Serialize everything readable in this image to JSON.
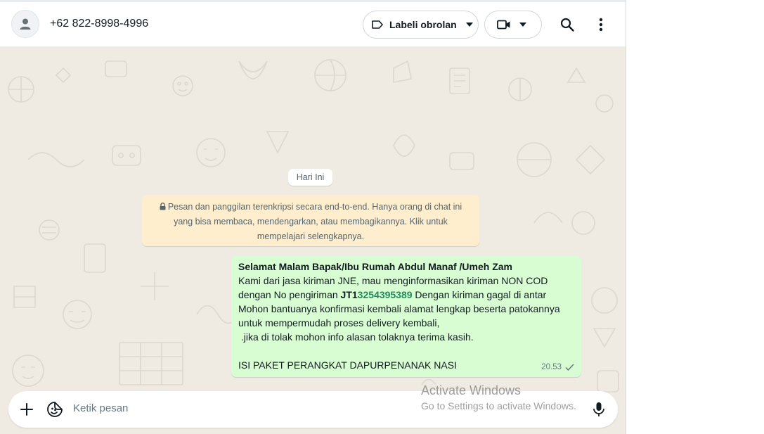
{
  "header": {
    "contact_name": "+62 822-8998-4996",
    "label_button": "Labeli obrolan"
  },
  "chat": {
    "date_chip": "Hari Ini",
    "encryption_notice": "Pesan dan panggilan terenkripsi secara end-to-end. Hanya orang di chat ini yang bisa membaca, mendengarkan, atau membagikannya. Klik untuk mempelajari selengkapnya.",
    "message": {
      "line1": "Selamat Malam Bapak/Ibu Rumah Abdul Manaf /Umeh Zam",
      "line2": "Kami dari jasa kiriman JNE, mau menginformasikan kiriman NON COD",
      "line3_pre": "dengan No pengiriman ",
      "tracking_prefix": "JT1",
      "tracking_number": "3254395389",
      "line3_post": " Dengan kiriman gagal di antar",
      "line4": "Mohon bantuanya konfirmasi kembali alamat lengkap beserta patokannya",
      "line5": "untuk mempermudah proses delivery kembali,",
      "line6": " .jika di tolak mohon info alasan tolaknya terima kasih.",
      "line7": "ISI PAKET PERANGKAT DAPURPENANAK NASI",
      "time": "20.53"
    }
  },
  "composer": {
    "placeholder": "Ketik pesan"
  },
  "watermark": {
    "title": "Activate Windows",
    "subtitle": "Go to Settings to activate Windows."
  },
  "colors": {
    "chat_background": "#efeae2",
    "outgoing_bubble": "#d9fdd3",
    "system_notice": "#ffeecd",
    "tracking_link": "#1f8b5f"
  }
}
